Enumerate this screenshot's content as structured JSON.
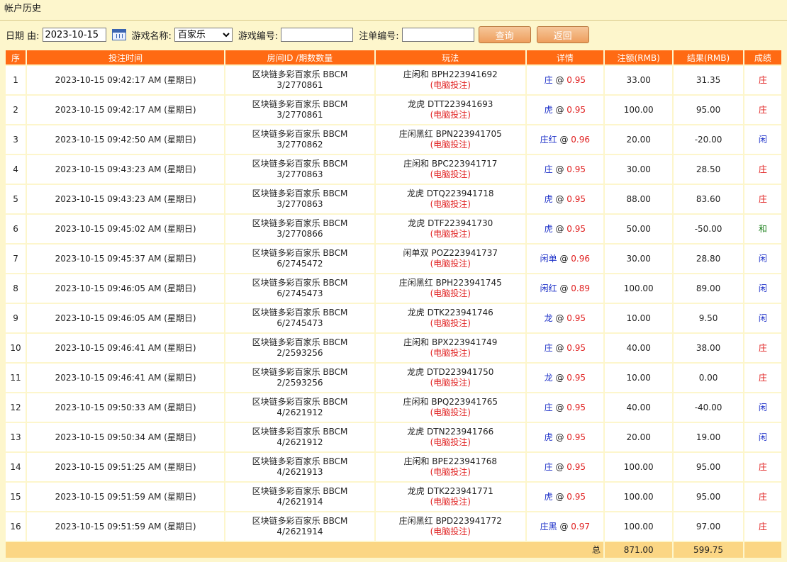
{
  "title": "帐户历史",
  "filter": {
    "date_label": "日期 由:",
    "date_value": "2023-10-15",
    "game_name_label": "游戏名称:",
    "game_selected": "百家乐",
    "game_number_label": "游戏编号:",
    "game_number_value": "",
    "bet_number_label": "注单编号:",
    "bet_number_value": "",
    "query_label": "查询",
    "back_label": "返回"
  },
  "columns": [
    "序",
    "投注时间",
    "房间ID /期数数量",
    "玩法",
    "详情",
    "注额(RMB)",
    "结果(RMB)",
    "成绩"
  ],
  "rows": [
    {
      "no": "1",
      "time": "2023-10-15 09:42:17 AM (星期日)",
      "room": "区块链多彩百家乐 BBCM",
      "period": "3/2770861",
      "play": "庄闲和 BPH223941692",
      "tag": "(电脑投注)",
      "pick": "庄",
      "odds": "0.95",
      "amount": "33.00",
      "result": "31.35",
      "outcome": "庄",
      "outcome_color": "#e02020"
    },
    {
      "no": "2",
      "time": "2023-10-15 09:42:17 AM (星期日)",
      "room": "区块链多彩百家乐 BBCM",
      "period": "3/2770861",
      "play": "龙虎 DTT223941693",
      "tag": "(电脑投注)",
      "pick": "虎",
      "odds": "0.95",
      "amount": "100.00",
      "result": "95.00",
      "outcome": "庄",
      "outcome_color": "#e02020"
    },
    {
      "no": "3",
      "time": "2023-10-15 09:42:50 AM (星期日)",
      "room": "区块链多彩百家乐 BBCM",
      "period": "3/2770862",
      "play": "庄闲黑红 BPN223941705",
      "tag": "(电脑投注)",
      "pick": "庄红",
      "odds": "0.96",
      "amount": "20.00",
      "result": "-20.00",
      "outcome": "闲",
      "outcome_color": "#1b2fc8"
    },
    {
      "no": "4",
      "time": "2023-10-15 09:43:23 AM (星期日)",
      "room": "区块链多彩百家乐 BBCM",
      "period": "3/2770863",
      "play": "庄闲和 BPC223941717",
      "tag": "(电脑投注)",
      "pick": "庄",
      "odds": "0.95",
      "amount": "30.00",
      "result": "28.50",
      "outcome": "庄",
      "outcome_color": "#e02020"
    },
    {
      "no": "5",
      "time": "2023-10-15 09:43:23 AM (星期日)",
      "room": "区块链多彩百家乐 BBCM",
      "period": "3/2770863",
      "play": "龙虎 DTQ223941718",
      "tag": "(电脑投注)",
      "pick": "虎",
      "odds": "0.95",
      "amount": "88.00",
      "result": "83.60",
      "outcome": "庄",
      "outcome_color": "#e02020"
    },
    {
      "no": "6",
      "time": "2023-10-15 09:45:02 AM (星期日)",
      "room": "区块链多彩百家乐 BBCM",
      "period": "3/2770866",
      "play": "龙虎 DTF223941730",
      "tag": "(电脑投注)",
      "pick": "虎",
      "odds": "0.95",
      "amount": "50.00",
      "result": "-50.00",
      "outcome": "和",
      "outcome_color": "#1a7f1a"
    },
    {
      "no": "7",
      "time": "2023-10-15 09:45:37 AM (星期日)",
      "room": "区块链多彩百家乐 BBCM",
      "period": "6/2745472",
      "play": "闲单双 POZ223941737",
      "tag": "(电脑投注)",
      "pick": "闲单",
      "odds": "0.96",
      "amount": "30.00",
      "result": "28.80",
      "outcome": "闲",
      "outcome_color": "#1b2fc8"
    },
    {
      "no": "8",
      "time": "2023-10-15 09:46:05 AM (星期日)",
      "room": "区块链多彩百家乐 BBCM",
      "period": "6/2745473",
      "play": "庄闲黑红 BPH223941745",
      "tag": "(电脑投注)",
      "pick": "闲红",
      "odds": "0.89",
      "amount": "100.00",
      "result": "89.00",
      "outcome": "闲",
      "outcome_color": "#1b2fc8"
    },
    {
      "no": "9",
      "time": "2023-10-15 09:46:05 AM (星期日)",
      "room": "区块链多彩百家乐 BBCM",
      "period": "6/2745473",
      "play": "龙虎 DTK223941746",
      "tag": "(电脑投注)",
      "pick": "龙",
      "odds": "0.95",
      "amount": "10.00",
      "result": "9.50",
      "outcome": "闲",
      "outcome_color": "#1b2fc8"
    },
    {
      "no": "10",
      "time": "2023-10-15 09:46:41 AM (星期日)",
      "room": "区块链多彩百家乐 BBCM",
      "period": "2/2593256",
      "play": "庄闲和 BPX223941749",
      "tag": "(电脑投注)",
      "pick": "庄",
      "odds": "0.95",
      "amount": "40.00",
      "result": "38.00",
      "outcome": "庄",
      "outcome_color": "#e02020"
    },
    {
      "no": "11",
      "time": "2023-10-15 09:46:41 AM (星期日)",
      "room": "区块链多彩百家乐 BBCM",
      "period": "2/2593256",
      "play": "龙虎 DTD223941750",
      "tag": "(电脑投注)",
      "pick": "龙",
      "odds": "0.95",
      "amount": "10.00",
      "result": "0.00",
      "outcome": "庄",
      "outcome_color": "#e02020"
    },
    {
      "no": "12",
      "time": "2023-10-15 09:50:33 AM (星期日)",
      "room": "区块链多彩百家乐 BBCM",
      "period": "4/2621912",
      "play": "庄闲和 BPQ223941765",
      "tag": "(电脑投注)",
      "pick": "庄",
      "odds": "0.95",
      "amount": "40.00",
      "result": "-40.00",
      "outcome": "闲",
      "outcome_color": "#1b2fc8"
    },
    {
      "no": "13",
      "time": "2023-10-15 09:50:34 AM (星期日)",
      "room": "区块链多彩百家乐 BBCM",
      "period": "4/2621912",
      "play": "龙虎 DTN223941766",
      "tag": "(电脑投注)",
      "pick": "虎",
      "odds": "0.95",
      "amount": "20.00",
      "result": "19.00",
      "outcome": "闲",
      "outcome_color": "#1b2fc8"
    },
    {
      "no": "14",
      "time": "2023-10-15 09:51:25 AM (星期日)",
      "room": "区块链多彩百家乐 BBCM",
      "period": "4/2621913",
      "play": "庄闲和 BPE223941768",
      "tag": "(电脑投注)",
      "pick": "庄",
      "odds": "0.95",
      "amount": "100.00",
      "result": "95.00",
      "outcome": "庄",
      "outcome_color": "#e02020"
    },
    {
      "no": "15",
      "time": "2023-10-15 09:51:59 AM (星期日)",
      "room": "区块链多彩百家乐 BBCM",
      "period": "4/2621914",
      "play": "龙虎 DTK223941771",
      "tag": "(电脑投注)",
      "pick": "虎",
      "odds": "0.95",
      "amount": "100.00",
      "result": "95.00",
      "outcome": "庄",
      "outcome_color": "#e02020"
    },
    {
      "no": "16",
      "time": "2023-10-15 09:51:59 AM (星期日)",
      "room": "区块链多彩百家乐 BBCM",
      "period": "4/2621914",
      "play": "庄闲黑红 BPD223941772",
      "tag": "(电脑投注)",
      "pick": "庄黑",
      "odds": "0.97",
      "amount": "100.00",
      "result": "97.00",
      "outcome": "庄",
      "outcome_color": "#e02020"
    }
  ],
  "totals": {
    "label": "总",
    "amount": "871.00",
    "result": "599.75"
  },
  "colors": {
    "header_bg": "#ff6a13",
    "page_bg": "#fdf6cc",
    "total_row_bg": "#fbd684",
    "positive": "#1b2fc8",
    "negative": "#e02020"
  }
}
